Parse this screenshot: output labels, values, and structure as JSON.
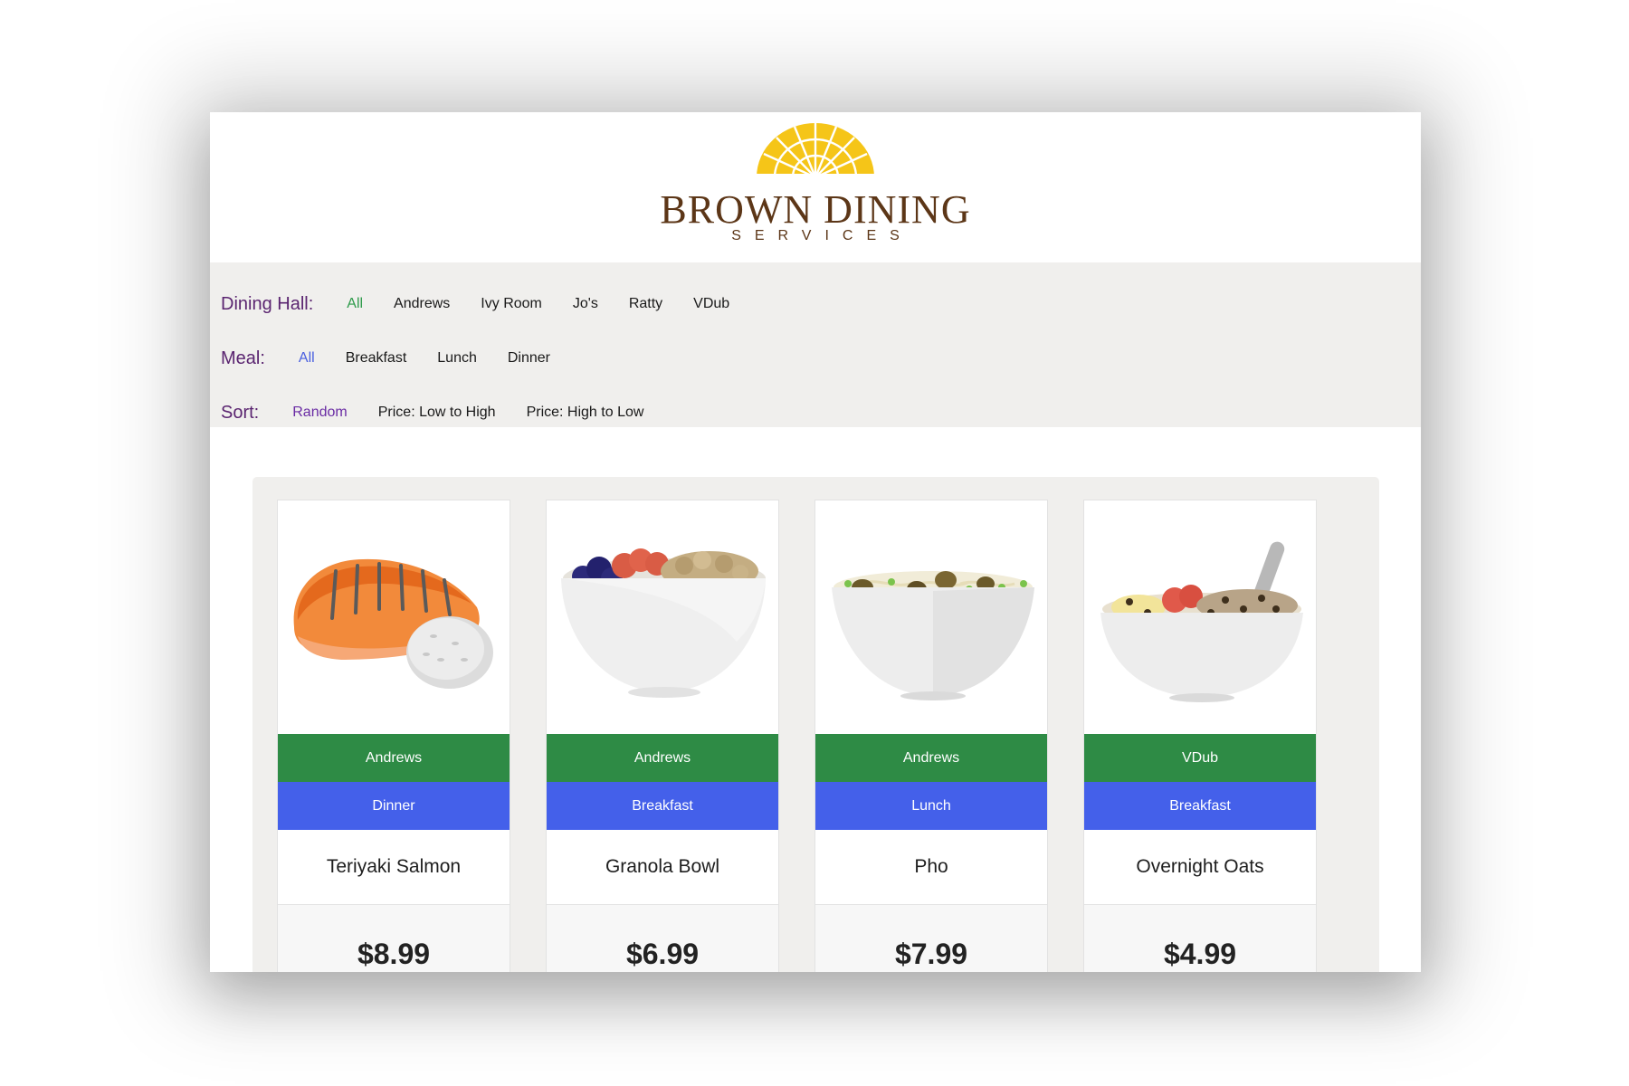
{
  "brand": {
    "title": "BROWN DINING",
    "subtitle": "SERVICES"
  },
  "filters": {
    "hall": {
      "label": "Dining Hall:",
      "options": [
        "All",
        "Andrews",
        "Ivy Room",
        "Jo's",
        "Ratty",
        "VDub"
      ],
      "selected": "All"
    },
    "meal": {
      "label": "Meal:",
      "options": [
        "All",
        "Breakfast",
        "Lunch",
        "Dinner"
      ],
      "selected": "All"
    },
    "sort": {
      "label": "Sort:",
      "options": [
        "Random",
        "Price: Low to High",
        "Price: High to Low"
      ],
      "selected": "Random"
    }
  },
  "items": [
    {
      "hall": "Andrews",
      "meal": "Dinner",
      "name": "Teriyaki Salmon",
      "price": "$8.99",
      "icon": "salmon-icon"
    },
    {
      "hall": "Andrews",
      "meal": "Breakfast",
      "name": "Granola Bowl",
      "price": "$6.99",
      "icon": "granola-bowl-icon"
    },
    {
      "hall": "Andrews",
      "meal": "Lunch",
      "name": "Pho",
      "price": "$7.99",
      "icon": "pho-bowl-icon"
    },
    {
      "hall": "VDub",
      "meal": "Breakfast",
      "name": "Overnight Oats",
      "price": "$4.99",
      "icon": "oats-bowl-icon"
    }
  ],
  "colors": {
    "hall_badge": "#2e8b45",
    "meal_badge": "#4460ea",
    "label_purple": "#5a2470",
    "logo_gold": "#f5c518",
    "logo_brown": "#5c3617"
  }
}
